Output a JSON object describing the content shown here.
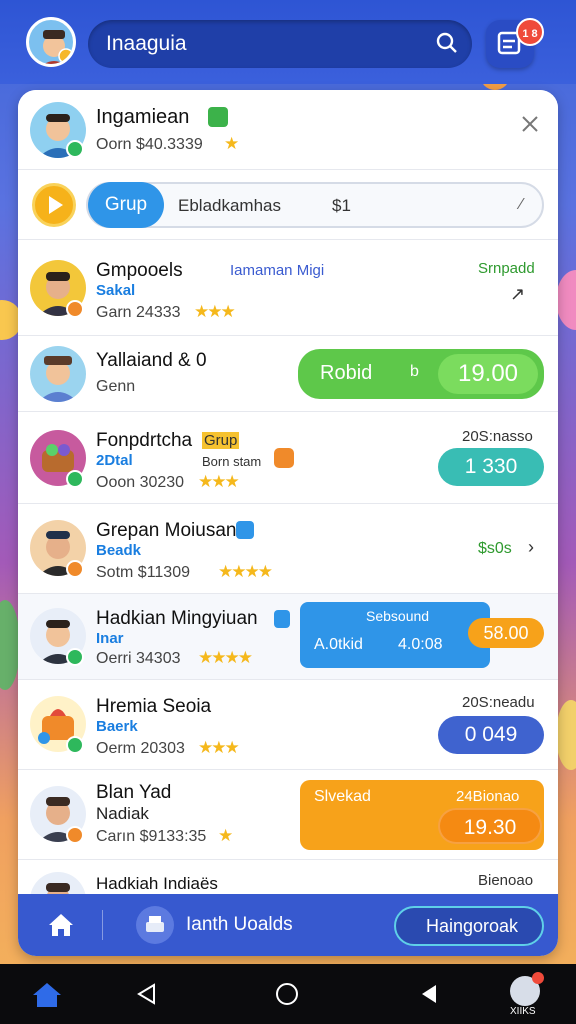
{
  "header": {
    "search_text": "Inaaguia",
    "badge": "1 8"
  },
  "featured": {
    "name": "Ingamiean",
    "meta": "Oorn $40.3339"
  },
  "group_bar": {
    "button": "Grup",
    "text": "Ebladkamhas",
    "suffix": "$1"
  },
  "rows": [
    {
      "name": "Gmpooels",
      "tag": "Iamaman Migi",
      "sub": "Sakal",
      "meta": "Garn 24333",
      "side": "Srnpadd",
      "stars": "★★★"
    },
    {
      "name": "Yallaiand & 0",
      "meta": "Genn",
      "btn_label": "Robid",
      "btn_mid": "b",
      "btn_value": "19.00"
    },
    {
      "name": "Fonpdrtcha",
      "tag": "Grup",
      "sub": "2Dtal",
      "sub2": "Born stam",
      "meta": "Ooon 30230",
      "side": "20S:nasso",
      "pill": "1 330",
      "stars": "★★★"
    },
    {
      "name": "Grepan Moiusan",
      "sub": "Beadk",
      "meta": "Sotm $11309",
      "side": "$s0s",
      "stars": "★★★★"
    },
    {
      "name": "Hadkian Mingyiuan",
      "sub": "Inar",
      "meta": "Oerri 34303",
      "box_title": "Sebsound",
      "box_left": "A.0tkid",
      "box_right": "4.0:08",
      "pill": "58.00",
      "stars": "★★★★"
    },
    {
      "name": "Hremia Seoia",
      "sub": "Baerk",
      "meta": "Oerm 20303",
      "side": "20S:neadu",
      "pill": "0 049",
      "stars": "★★★"
    },
    {
      "name": "Blan Yad",
      "sub": "Nadiak",
      "meta": "Carın $9133:35",
      "box_title": "Slvekad",
      "box_side": "24Bionao",
      "pill": "19.30",
      "stars": "★"
    },
    {
      "name": "Hadkiah Indiaës",
      "side": "Bienoao"
    }
  ],
  "bottom_nav": {
    "middle": "Ianth Uoalds",
    "right": "Haingoroak"
  },
  "system_bar": {
    "profile_label": "XIIKS"
  },
  "colors": {
    "primary": "#3759cf",
    "green": "#5ec84a",
    "teal": "#39bdb4",
    "orange": "#f7a21a",
    "blue": "#2f95e8"
  }
}
